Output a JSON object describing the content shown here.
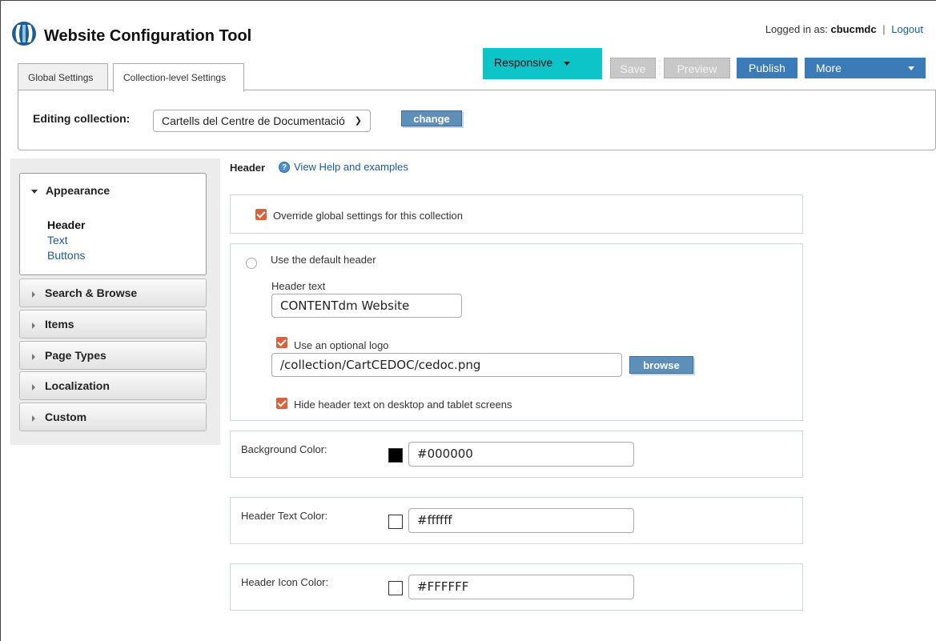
{
  "app": {
    "title": "Website Configuration Tool",
    "logged_in_prefix": "Logged in as:",
    "username": "cbucmdc",
    "separator": "|",
    "logout_label": "Logout"
  },
  "tabs": [
    {
      "label": "Global Settings",
      "active": false
    },
    {
      "label": "Collection-level Settings",
      "active": true
    }
  ],
  "toolbar": {
    "responsive_label": "Responsive",
    "save_label": "Save",
    "preview_label": "Preview",
    "publish_label": "Publish",
    "more_label": "More"
  },
  "editing": {
    "label": "Editing collection:",
    "selected_collection": "Cartells del Centre de Documentació",
    "change_label": "change"
  },
  "sidebar": {
    "open_section": {
      "label": "Appearance",
      "items": [
        {
          "label": "Header",
          "active": true
        },
        {
          "label": "Text",
          "active": false
        },
        {
          "label": "Buttons",
          "active": false
        }
      ]
    },
    "collapsed_sections": [
      "Search & Browse",
      "Items",
      "Page Types",
      "Localization",
      "Custom"
    ]
  },
  "main": {
    "section_title": "Header",
    "help_icon_glyph": "?",
    "help_link": "View Help and examples",
    "override_label": "Override global settings for this collection",
    "override_checked": true,
    "default_header_label": "Use the default header",
    "default_header_selected": false,
    "header_text_label": "Header text",
    "header_text_value": "CONTENTdm Website",
    "logo_label": "Use an optional logo",
    "logo_checked": true,
    "logo_path": "/collection/CartCEDOC/cedoc.png",
    "browse_label": "browse",
    "hide_text_label": "Hide header text on desktop and tablet screens",
    "hide_text_checked": true,
    "colors": [
      {
        "label": "Background Color:",
        "value": "#000000",
        "swatch": "#000000"
      },
      {
        "label": "Header Text Color:",
        "value": "#ffffff",
        "swatch": "#ffffff"
      },
      {
        "label": "Header Icon Color:",
        "value": "#FFFFFF",
        "swatch": "#FFFFFF"
      }
    ]
  },
  "theme": {
    "accent_teal": "#0dc5c8",
    "button_blue": "#3a7bb8",
    "checkbox_orange": "#d9623b",
    "link_blue": "#1a5a9a"
  },
  "icons": {
    "logo": "contentdm-logo-icon",
    "help": "help-circle-icon",
    "dropdown": "chevron-down-icon"
  }
}
